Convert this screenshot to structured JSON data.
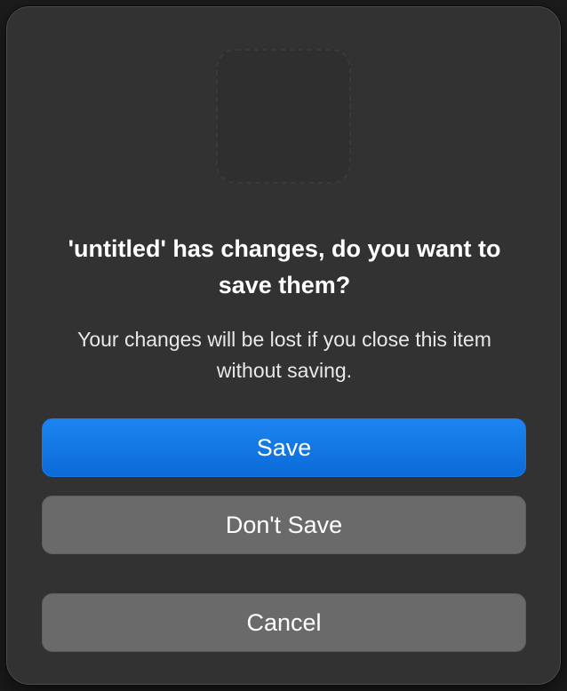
{
  "dialog": {
    "title": "'untitled' has changes, do you want to save them?",
    "message": "Your changes will be lost if you close this item without saving.",
    "icon": "app-icon-placeholder",
    "buttons": {
      "save_label": "Save",
      "dont_save_label": "Don't Save",
      "cancel_label": "Cancel"
    },
    "colors": {
      "background": "#323232",
      "primary_button": "#0b6bd8",
      "secondary_button": "#6a6a6a"
    }
  }
}
